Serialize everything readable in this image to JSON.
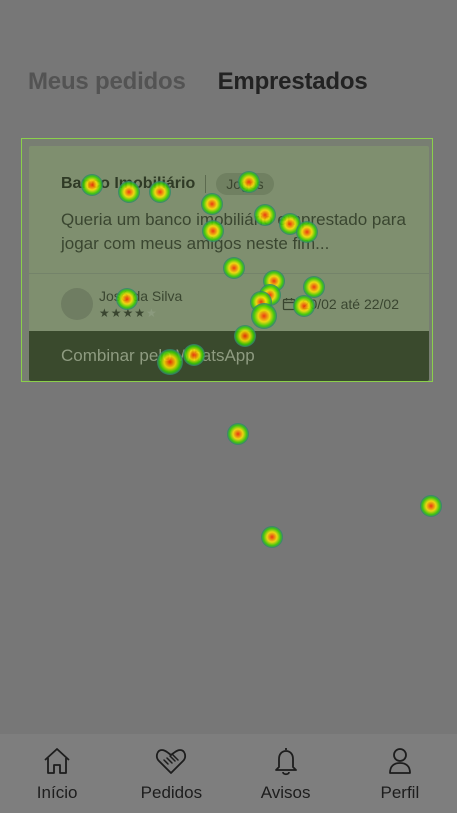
{
  "tabs": {
    "my_orders": "Meus pedidos",
    "borrowed": "Emprestados"
  },
  "card": {
    "title": "Banco Imobiliário",
    "tag": "Jogos",
    "description": "Queria um banco imobiliário emprestado para jogar com meus amigos neste fim...",
    "owner_name": "José da Silva",
    "rating_filled": "★★★★",
    "rating_empty": "★",
    "rating_value": 4,
    "rating_max": 5,
    "dates": "20/02 até 22/02",
    "whatsapp_button": "Combinar pelo WhatsApp"
  },
  "nav": {
    "home": "Início",
    "orders": "Pedidos",
    "notices": "Avisos",
    "profile": "Perfil"
  },
  "icons": {
    "home": "home-icon",
    "orders": "handshake-icon",
    "notices": "bell-icon",
    "profile": "user-icon",
    "calendar": "calendar-icon"
  },
  "colors": {
    "background": "#777777",
    "card_bg": "#7f8f6f",
    "whatsapp_bar": "#3a4a2d",
    "highlight_border": "#8bd04b"
  }
}
